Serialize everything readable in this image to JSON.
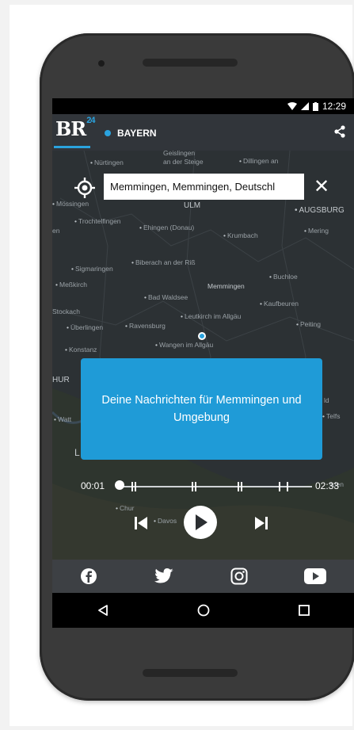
{
  "status_bar": {
    "time": "12:29"
  },
  "app": {
    "logo_text": "BR",
    "logo_superscript": "24",
    "region_label": "BAYERN",
    "accent_color": "#2aa3df",
    "share_icon": "share-icon"
  },
  "search": {
    "value": "Memmingen, Memmingen, Deutschl",
    "locate_icon": "crosshair-icon",
    "close_icon": "close-icon",
    "close_glyph": "✕"
  },
  "map_labels": {
    "nurtingen": "Nürtingen",
    "geislingen": "Geislingen",
    "an_der_steige": "an der Steige",
    "dillingen": "Dillingen an",
    "mossingen": "Mössingen",
    "ulm": "ULM",
    "augsburg": "AUGSBURG",
    "en": "en",
    "trochtelfingen": "Trochtelfingen",
    "ehingen": "Ehingen (Donau)",
    "krumbach": "Krumbach",
    "mering": "Mering",
    "sigmaringen": "Sigmaringen",
    "biberach": "Biberach an der Riß",
    "buchloe": "Buchloe",
    "messkirch": "Meßkirch",
    "memmingen": "Memmingen",
    "bad_waldsee": "Bad Waldsee",
    "kaufbeuren": "Kaufbeuren",
    "stockach": "Stockach",
    "leutkirch": "Leutkirch im Allgäu",
    "uberlingen": "Überlingen",
    "ravensburg": "Ravensburg",
    "peiting": "Peiting",
    "wangen": "Wangen im Allgäu",
    "konstanz": "Konstanz",
    "thur": "HUR",
    "wattwil": "Watt",
    "telfs": "Telfs",
    "ld": "ld",
    "l": "L",
    "chur": "Chur",
    "davos": "Davos",
    "ilden": "ilden"
  },
  "news_box": {
    "text": "Deine Nachrichten für Memmingen und Umgebung"
  },
  "player": {
    "current_time": "00:01",
    "end_time": "02:33",
    "progress": 0.01
  },
  "social": [
    "facebook-icon",
    "twitter-icon",
    "instagram-icon",
    "youtube-icon"
  ],
  "nav": [
    "back-icon",
    "home-icon",
    "recents-icon"
  ]
}
